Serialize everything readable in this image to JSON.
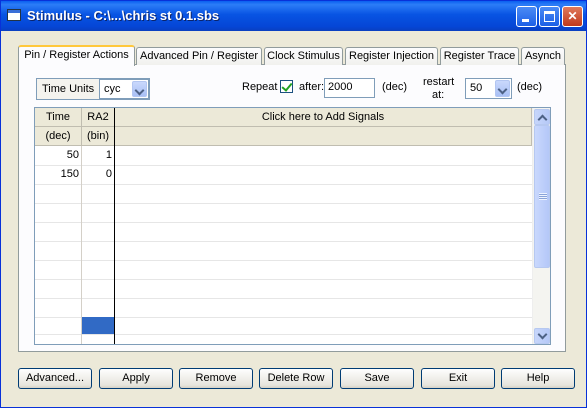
{
  "window": {
    "title": "Stimulus - C:\\...\\chris st 0.1.sbs"
  },
  "tabs": [
    {
      "label": "Pin / Register Actions"
    },
    {
      "label": "Advanced Pin / Register"
    },
    {
      "label": "Clock Stimulus"
    },
    {
      "label": "Register Injection"
    },
    {
      "label": "Register Trace"
    },
    {
      "label": "Asynch"
    }
  ],
  "controls": {
    "time_units_label": "Time Units",
    "time_units_value": "cyc",
    "repeat_label": "Repeat",
    "repeat_checked": true,
    "after_label": "after:",
    "after_value": "2000",
    "after_unit": "(dec)",
    "restart_label_1": "restart",
    "restart_label_2": "at:",
    "restart_value": "50",
    "restart_unit": "(dec)"
  },
  "grid": {
    "columns": [
      {
        "name": "Time",
        "format": "(dec)"
      },
      {
        "name": "RA2",
        "format": "(bin)"
      }
    ],
    "add_signals_label": "Click here to Add Signals",
    "rows": [
      {
        "time": "50",
        "ra2": "1"
      },
      {
        "time": "150",
        "ra2": "0"
      }
    ],
    "selected_color": "#316ac5"
  },
  "buttons": {
    "advanced": "Advanced...",
    "apply": "Apply",
    "remove": "Remove",
    "delete_row": "Delete Row",
    "save": "Save",
    "exit": "Exit",
    "help": "Help"
  }
}
